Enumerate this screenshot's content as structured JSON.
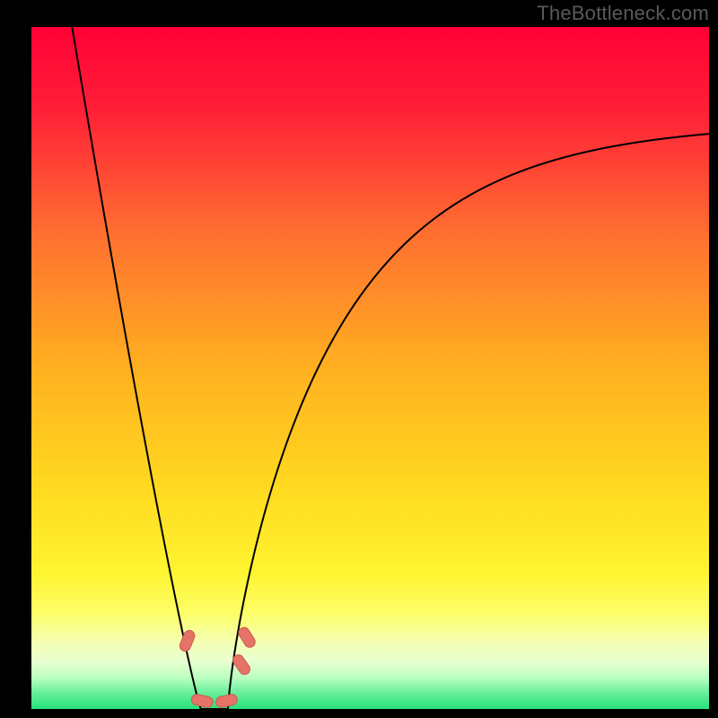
{
  "watermark": "TheBottleneck.com",
  "colors": {
    "frame": "#000000",
    "curve": "#000000",
    "marker_fill": "#e57368",
    "marker_stroke": "#cc5a50",
    "gradient_stops": [
      {
        "offset": "0%",
        "color": "#ff0035"
      },
      {
        "offset": "12%",
        "color": "#ff1f38"
      },
      {
        "offset": "30%",
        "color": "#ff6e30"
      },
      {
        "offset": "50%",
        "color": "#ffb020"
      },
      {
        "offset": "67%",
        "color": "#ffd820"
      },
      {
        "offset": "80%",
        "color": "#fff430"
      },
      {
        "offset": "86%",
        "color": "#fcff68"
      },
      {
        "offset": "90%",
        "color": "#f5ffb0"
      },
      {
        "offset": "93%",
        "color": "#e8ffd0"
      },
      {
        "offset": "95.5%",
        "color": "#b8ffc0"
      },
      {
        "offset": "97.5%",
        "color": "#6cf09c"
      },
      {
        "offset": "100%",
        "color": "#26e07a"
      }
    ]
  },
  "chart_data": {
    "type": "line",
    "title": "",
    "xlabel": "",
    "ylabel": "",
    "xlim": [
      0,
      100
    ],
    "ylim": [
      0,
      100
    ],
    "x_optimum": 27,
    "left_start": {
      "x": 6,
      "y": 100
    },
    "left_slope_scale": 60,
    "right_end": {
      "x": 100,
      "y": 86
    },
    "right_shape_k": 0.052,
    "flat_halfwidth_x": 2.0,
    "markers": [
      {
        "x": 23.0,
        "y": 10.0,
        "shape": "capsule",
        "angle": -68
      },
      {
        "x": 25.2,
        "y": 1.2,
        "shape": "capsule",
        "angle": 12
      },
      {
        "x": 28.8,
        "y": 1.2,
        "shape": "capsule",
        "angle": -12
      },
      {
        "x": 31.0,
        "y": 6.5,
        "shape": "capsule",
        "angle": 55
      },
      {
        "x": 31.8,
        "y": 10.5,
        "shape": "capsule",
        "angle": 58
      }
    ]
  }
}
